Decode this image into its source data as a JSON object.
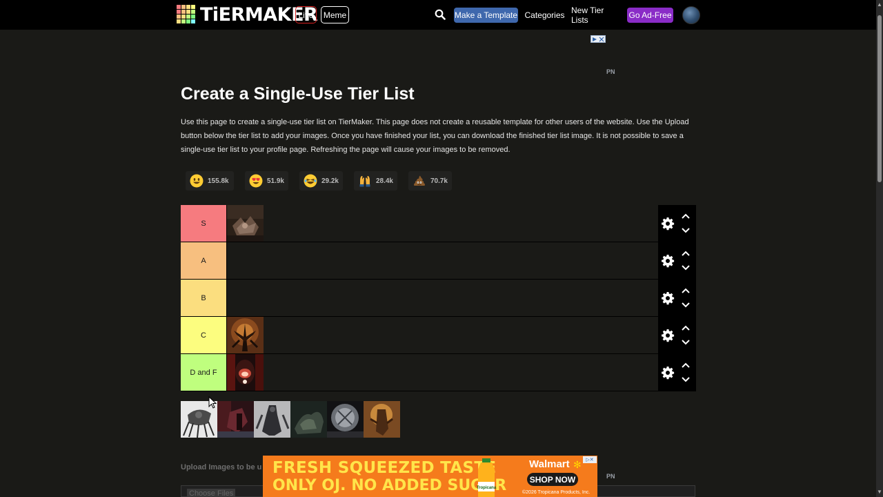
{
  "header": {
    "logo_text": "TiERMAKER",
    "live_label": "Live",
    "meme_label": "Meme",
    "make_template_label": "Make a Template",
    "categories_label": "Categories",
    "new_tier_lists_label": "New Tier Lists",
    "ad_free_label": "Go Ad-Free",
    "colors": {
      "make_template": "#3f68ad",
      "ad_free": "#8a2cc7",
      "live_border": "#d92020"
    }
  },
  "ads": {
    "pn_label": "PN"
  },
  "page": {
    "title": "Create a Single-Use Tier List",
    "description": "Use this page to create a single-use tier list on TierMaker. This page does not create a reusable template for other users of the website. Use the Upload button below the tier list to add your images. Once you have finished your list, you can download the finished tier list image. It is not possible to save a single-use tier list to your profile page. Refreshing the page will cause your images to be removed."
  },
  "reactions": [
    {
      "icon": "smiley-emoji-icon",
      "count": "155.8k"
    },
    {
      "icon": "heart-eyes-emoji-icon",
      "count": "51.9k"
    },
    {
      "icon": "laughing-emoji-icon",
      "count": "29.2k"
    },
    {
      "icon": "raised-hands-emoji-icon",
      "count": "28.4k"
    },
    {
      "icon": "poop-emoji-icon",
      "count": "70.7k"
    }
  ],
  "tiers": [
    {
      "label": "S",
      "color": "#f67b7f",
      "items": 1
    },
    {
      "label": "A",
      "color": "#f7bf7f",
      "items": 0
    },
    {
      "label": "B",
      "color": "#fbde7f",
      "items": 0
    },
    {
      "label": "C",
      "color": "#fcfd7f",
      "items": 1
    },
    {
      "label": "D and F",
      "color": "#bffe7e",
      "items": 1
    }
  ],
  "pool_count": 6,
  "upload": {
    "label": "Upload Images to be u",
    "button_label": "Choose Files"
  },
  "bottom_ad": {
    "line1": "FRESH SQUEEZED TASTE",
    "line2": "ONLY OJ. NO ADDED SUGAR",
    "brand": "Walmart",
    "cta": "SHOP NOW",
    "legal": "©2026 Tropicana Products, Inc.",
    "bottle_label": "Tropicana"
  }
}
